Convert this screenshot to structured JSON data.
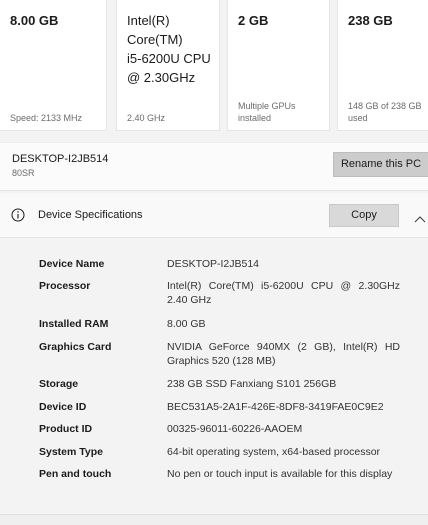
{
  "cards": {
    "ram": {
      "value": "8.00 GB",
      "sub": "Speed: 2133 MHz"
    },
    "cpu": {
      "value_lines": [
        "Intel(R)",
        "Core(TM)",
        "i5-6200U CPU",
        "@ 2.30GHz"
      ],
      "sub": "2.40 GHz"
    },
    "gpu": {
      "value": "2 GB",
      "sub_lines": [
        "Multiple GPUs",
        "installed"
      ]
    },
    "storage": {
      "value": "238 GB",
      "sub_lines": [
        "148 GB of 238 GB",
        "used"
      ]
    }
  },
  "device": {
    "name": "DESKTOP-I2JB514",
    "model": "80SR",
    "rename_label": "Rename this PC"
  },
  "specs": {
    "title": "Device Specifications",
    "copy_label": "Copy",
    "rows": [
      {
        "label": "Device Name",
        "value": "DESKTOP-I2JB514"
      },
      {
        "label": "Processor",
        "value": "Intel(R) Core(TM) i5-6200U CPU @ 2.30GHz 2.40 GHz"
      },
      {
        "label": "Installed RAM",
        "value": "8.00 GB"
      },
      {
        "label": "Graphics Card",
        "value": "NVIDIA GeForce 940MX (2 GB), Intel(R) HD Graphics 520 (128 MB)"
      },
      {
        "label": "Storage",
        "value": "238 GB SSD Fanxiang S101 256GB"
      },
      {
        "label": "Device ID",
        "value": "BEC531A5-2A1F-426E-8DF8-3419FAE0C9E2"
      },
      {
        "label": "Product ID",
        "value": "00325-96011-60226-AAOEM"
      },
      {
        "label": "System Type",
        "value": "64-bit operating system, x64-based processor"
      },
      {
        "label": "Pen and touch",
        "value": "No pen or touch input is available for this display"
      }
    ]
  },
  "icons": {
    "info": "info-icon",
    "collapse": "chevron-up-icon"
  },
  "colors": {
    "background": "#f3f3f3",
    "card": "#ffffff",
    "button": "#cccccc"
  }
}
